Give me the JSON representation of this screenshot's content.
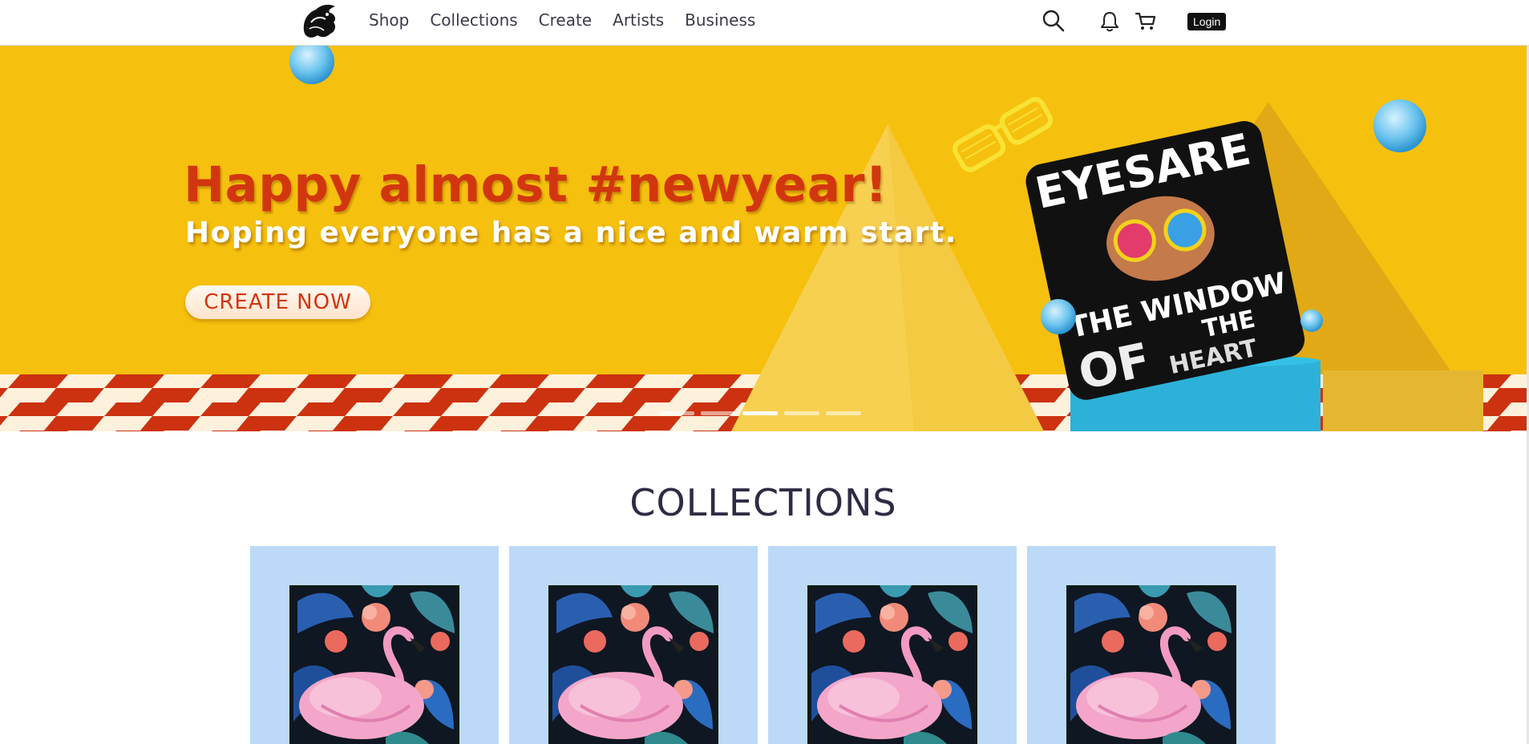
{
  "nav": {
    "items": [
      "Shop",
      "Collections",
      "Create",
      "Artists",
      "Business"
    ],
    "login_label": "Login"
  },
  "header_icons": [
    "search-icon",
    "bell-icon",
    "cart-icon"
  ],
  "banner": {
    "headline": "Happy almost #newyear!",
    "subline": "Hoping everyone has a nice and warm start.",
    "cta_label": "CREATE  NOW",
    "pillow_text": [
      "EYESARE",
      "THE WINDOW",
      "THE",
      "OF",
      "HEART"
    ],
    "slide_count": 5,
    "active_slide": 3
  },
  "collections": {
    "title": "COLLECTIONS",
    "cards": [
      {
        "image": "flamingo-tropical-print"
      },
      {
        "image": "flamingo-tropical-print"
      },
      {
        "image": "flamingo-tropical-print"
      },
      {
        "image": "flamingo-tropical-print"
      }
    ]
  },
  "colors": {
    "banner_bg": "#f6c00e",
    "headline": "#d2360e",
    "card_bg": "#bcdaf7",
    "title": "#2f2b45"
  }
}
